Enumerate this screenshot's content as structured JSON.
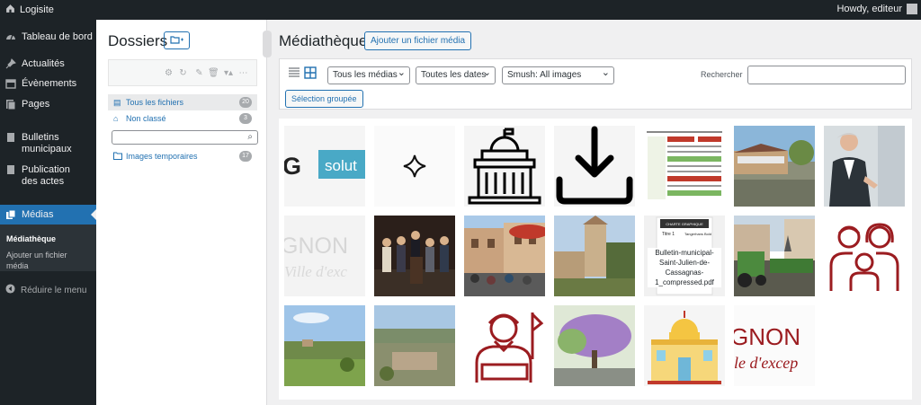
{
  "adminbar": {
    "site_name": "Logisite",
    "howdy": "Howdy, editeur"
  },
  "menu": {
    "items": [
      {
        "label": "Tableau de bord",
        "icon": "dashboard-icon"
      },
      {
        "label": "Actualités",
        "icon": "pin-icon"
      },
      {
        "label": "Évènements",
        "icon": "calendar-icon"
      },
      {
        "label": "Pages",
        "icon": "page-icon"
      },
      {
        "label": "Bulletins municipaux",
        "icon": "document-icon"
      },
      {
        "label": "Publication des actes",
        "icon": "document-icon"
      },
      {
        "label": "Médias",
        "icon": "media-icon"
      }
    ],
    "submenu": [
      "Médiathèque",
      "Ajouter un fichier média"
    ],
    "collapse": "Réduire le menu"
  },
  "folders": {
    "title": "Dossiers",
    "new_folder_icon": "folder-plus-icon",
    "items": [
      {
        "label": "Tous les fichiers",
        "count": "20"
      },
      {
        "label": "Non classé",
        "count": "3"
      },
      {
        "label": "Images temporaires",
        "count": "17"
      }
    ]
  },
  "library": {
    "title": "Médiathèque",
    "add_button": "Ajouter un fichier média",
    "filters": {
      "type": "Tous les médias",
      "date": "Toutes les dates",
      "smush": "Smush: All images"
    },
    "search_label": "Rechercher",
    "bulk_button": "Sélection groupée",
    "document_name": "Bulletin-municipal-Saint-Julien-de-Cassagnas-1_compressed.pdf",
    "doc_header": "CHARTE GRAPHIQUE",
    "doc_title": "Titre 1",
    "doc_font": "Tangerhans Bold",
    "logo_text_1": "G solut",
    "logo_text_2a": "GNON",
    "logo_text_2b": "Ville d'exc",
    "logo_text_3a": "GNON",
    "logo_text_3b": "le d'excep"
  },
  "colors": {
    "accent": "#2271b1",
    "adminbar": "#1d2327",
    "dark_red": "#9b1c20"
  }
}
